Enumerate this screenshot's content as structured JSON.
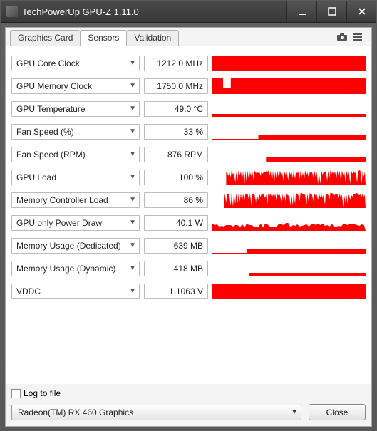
{
  "window": {
    "title": "TechPowerUp GPU-Z 1.11.0"
  },
  "tabs": {
    "graphics_card": "Graphics Card",
    "sensors": "Sensors",
    "validation": "Validation"
  },
  "sensors": [
    {
      "label": "GPU Core Clock",
      "value": "1212.0 MHz",
      "graph_type": "full"
    },
    {
      "label": "GPU Memory Clock",
      "value": "1750.0 MHz",
      "graph_type": "full_notch"
    },
    {
      "label": "GPU Temperature",
      "value": "49.0 °C",
      "graph_type": "low_band"
    },
    {
      "label": "Fan Speed (%)",
      "value": "33 %",
      "graph_type": "step_low"
    },
    {
      "label": "Fan Speed (RPM)",
      "value": "876 RPM",
      "graph_type": "step_low2"
    },
    {
      "label": "GPU Load",
      "value": "100 %",
      "graph_type": "noisy_high"
    },
    {
      "label": "Memory Controller Load",
      "value": "86 %",
      "graph_type": "noisy_high2"
    },
    {
      "label": "GPU only Power Draw",
      "value": "40.1 W",
      "graph_type": "noisy_low"
    },
    {
      "label": "Memory Usage (Dedicated)",
      "value": "639 MB",
      "graph_type": "step_mid"
    },
    {
      "label": "Memory Usage (Dynamic)",
      "value": "418 MB",
      "graph_type": "step_mid2"
    },
    {
      "label": "VDDC",
      "value": "1.1063 V",
      "graph_type": "full"
    }
  ],
  "footer": {
    "log_to_file": "Log to file",
    "gpu_select": "Radeon(TM) RX 460 Graphics",
    "close": "Close"
  },
  "colors": {
    "graph": "#ff0000"
  }
}
